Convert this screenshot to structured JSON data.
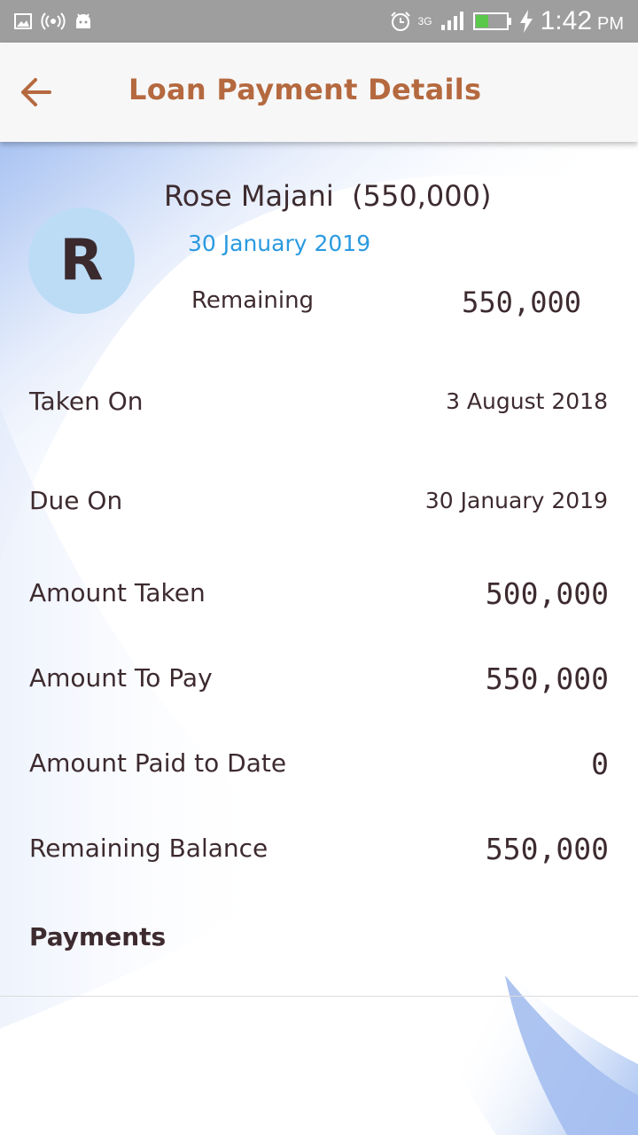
{
  "status_bar": {
    "network": "3G",
    "time": "1:42",
    "ampm": "PM",
    "icons": [
      "image-icon",
      "hotspot-icon",
      "android-icon",
      "alarm-icon",
      "signal-icon",
      "battery-icon",
      "charging-icon"
    ]
  },
  "header": {
    "back_icon": "arrow-left-icon",
    "title": "Loan Payment Details",
    "title_color": "#b5693f"
  },
  "borrower": {
    "initial": "R",
    "name": "Rose Majani",
    "amount": "(550,000)",
    "due_date": "30 January 2019",
    "remaining_label": "Remaining",
    "remaining_value": "550,000",
    "avatar_color": "#bcdcf6",
    "date_color": "#2a9ae0"
  },
  "details": {
    "taken_on_label": "Taken On",
    "taken_on_value": "3 August 2018",
    "due_on_label": "Due On",
    "due_on_value": "30 January 2019",
    "amount_taken_label": "Amount Taken",
    "amount_taken_value": "500,000",
    "amount_to_pay_label": "Amount To Pay",
    "amount_to_pay_value": "550,000",
    "paid_label": "Amount Paid to Date",
    "paid_value": "0",
    "balance_label": "Remaining Balance",
    "balance_value": "550,000"
  },
  "payments": {
    "title": "Payments"
  }
}
